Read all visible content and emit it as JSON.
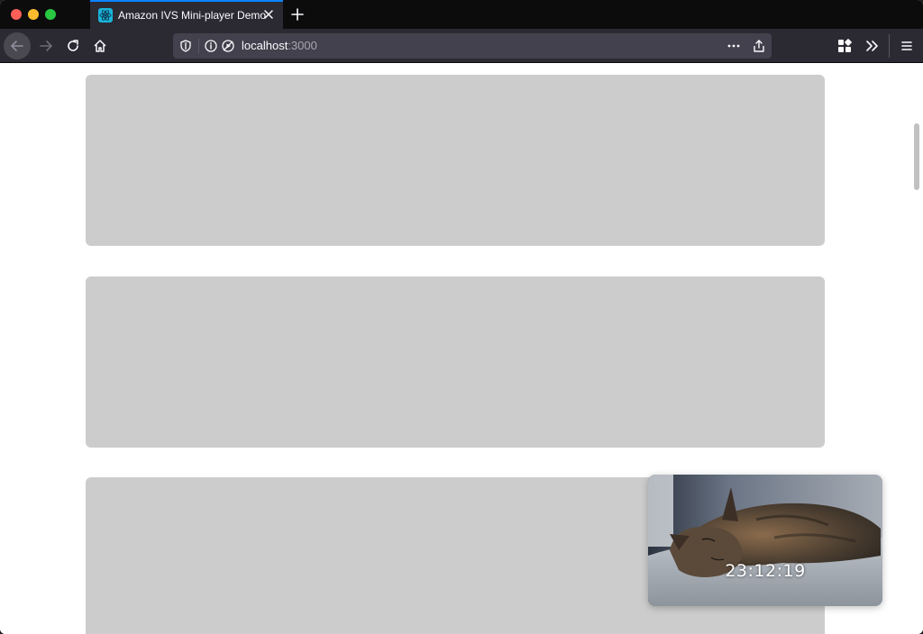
{
  "browser": {
    "tab": {
      "title": "Amazon IVS Mini-player Demo",
      "favicon": "react-logo-icon"
    },
    "url": {
      "host": "localhost",
      "port": ":3000"
    },
    "colors": {
      "accent": "#0a84ff",
      "toolbar": "#2b2a33",
      "tabstrip": "#0c0c0d"
    }
  },
  "page": {
    "cards": [
      {
        "color": "#cccccc"
      },
      {
        "color": "#cccccc"
      },
      {
        "color": "#cccccc"
      }
    ],
    "miniplayer": {
      "timestamp": "23:12:19",
      "subject": "sleeping-cat-video"
    }
  }
}
